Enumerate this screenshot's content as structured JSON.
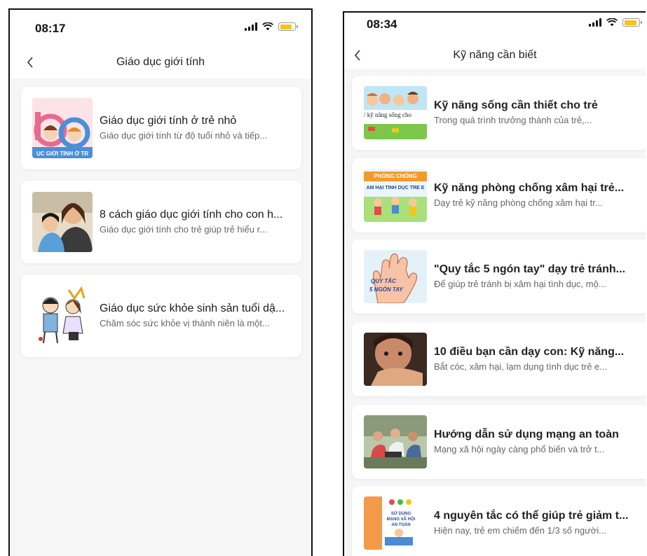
{
  "left_screen": {
    "status": {
      "time": "08:17"
    },
    "nav": {
      "title": "Giáo dục giới tính"
    },
    "articles": [
      {
        "title": "Giáo dục giới tính ở trẻ nhỏ",
        "description": "Giáo dục giới tính từ độ tuổi nhỏ và tiếp...",
        "thumb_text": "ỤC GIỚI TÍNH Ở TR"
      },
      {
        "title": "8 cách giáo dục giới tính cho con h...",
        "description": "Giáo dục giới tính cho trẻ giúp trẻ hiểu r..."
      },
      {
        "title": "Giáo dục sức khỏe sinh sản tuổi dậ...",
        "description": "Chăm sóc sức khỏe vị thành niên là một..."
      }
    ]
  },
  "right_screen": {
    "status": {
      "time": "08:34"
    },
    "nav": {
      "title": "Kỹ năng cần biết"
    },
    "articles": [
      {
        "title": "Kỹ năng sống cần thiết cho trẻ",
        "description": "Trong quá trình trưởng thành của trẻ,...",
        "thumb_text": "/ kỹ năng sống cho"
      },
      {
        "title": "Kỹ năng phòng chống xâm hại trẻ...",
        "description": "Dạy trẻ kỹ năng phòng chống xâm hại tr...",
        "thumb_text_1": "PHÒNG CHỐNG",
        "thumb_text_2": "ẤM HẠI TÌNH DỤC TRẺ E"
      },
      {
        "title": "\"Quy tắc 5 ngón tay\" dạy trẻ tránh...",
        "description": "Để giúp trẻ tránh bị xâm hại tình dục, mộ...",
        "thumb_text_1": "QUY TẮC",
        "thumb_text_2": "5 NGÓN TAY"
      },
      {
        "title": "10 điều bạn cần dạy con: Kỹ năng...",
        "description": "Bắt cóc, xâm hại, lạm dụng tình dục trẻ e..."
      },
      {
        "title": "Hướng dẫn sử dụng mạng an toàn",
        "description": "Mạng xã hội ngày càng phổ biến và trở t..."
      },
      {
        "title": "4 nguyên tắc có thể giúp trẻ giảm t...",
        "description": "Hiện nay, trẻ em chiếm đến 1/3 số người...",
        "thumb_text_1": "SỬ DỤNG",
        "thumb_text_2": "MẠNG XÃ HỘI",
        "thumb_text_3": "AN TOÀN"
      }
    ]
  },
  "colors": {
    "battery": "#f5c518",
    "background": "#f6f6f7",
    "card": "#ffffff"
  }
}
